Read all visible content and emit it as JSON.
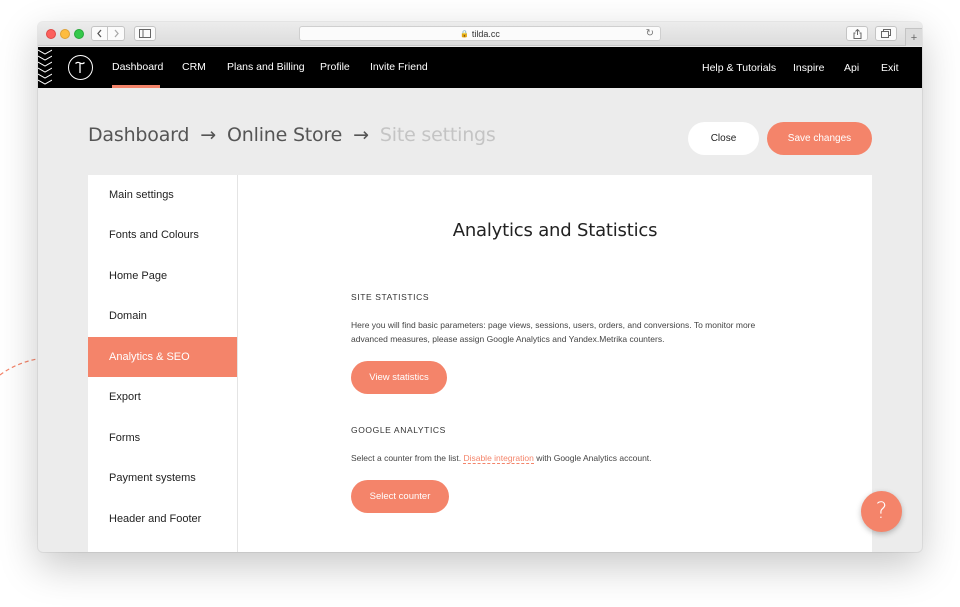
{
  "browser": {
    "url": "tilda.cc"
  },
  "nav": {
    "left_items": [
      {
        "label": "Dashboard"
      },
      {
        "label": "CRM"
      },
      {
        "label": "Plans and Billing"
      },
      {
        "label": "Profile"
      },
      {
        "label": "Invite Friend"
      }
    ],
    "right_items": [
      {
        "label": "Help & Tutorials"
      },
      {
        "label": "Inspire"
      },
      {
        "label": "Api"
      },
      {
        "label": "Exit"
      }
    ],
    "active": "Dashboard"
  },
  "breadcrumb": {
    "items": [
      "Dashboard",
      "Online Store",
      "Site settings"
    ],
    "separator": "→"
  },
  "header_buttons": {
    "close": "Close",
    "save": "Save changes"
  },
  "sidebar": {
    "items": [
      {
        "label": "Main settings"
      },
      {
        "label": "Fonts and Colours"
      },
      {
        "label": "Home Page"
      },
      {
        "label": "Domain"
      },
      {
        "label": "Analytics & SEO"
      },
      {
        "label": "Export"
      },
      {
        "label": "Forms"
      },
      {
        "label": "Payment systems"
      },
      {
        "label": "Header and Footer"
      }
    ],
    "active": "Analytics & SEO"
  },
  "content": {
    "title": "Analytics and Statistics",
    "site_statistics": {
      "heading": "SITE STATISTICS",
      "text": "Here you will find basic parameters: page views, sessions, users, orders, and conversions. To monitor more advanced measures, please assign Google Analytics and Yandex.Metrika counters.",
      "button": "View statistics"
    },
    "google_analytics": {
      "heading": "GOOGLE ANALYTICS",
      "text_before": "Select a counter from the list.",
      "link": "Disable integration",
      "text_after": "with Google Analytics account.",
      "button": "Select counter"
    }
  },
  "help": {
    "label": "?"
  },
  "colors": {
    "accent": "#f4846a",
    "nav_bg": "#000000",
    "page_bg": "#ececec"
  }
}
